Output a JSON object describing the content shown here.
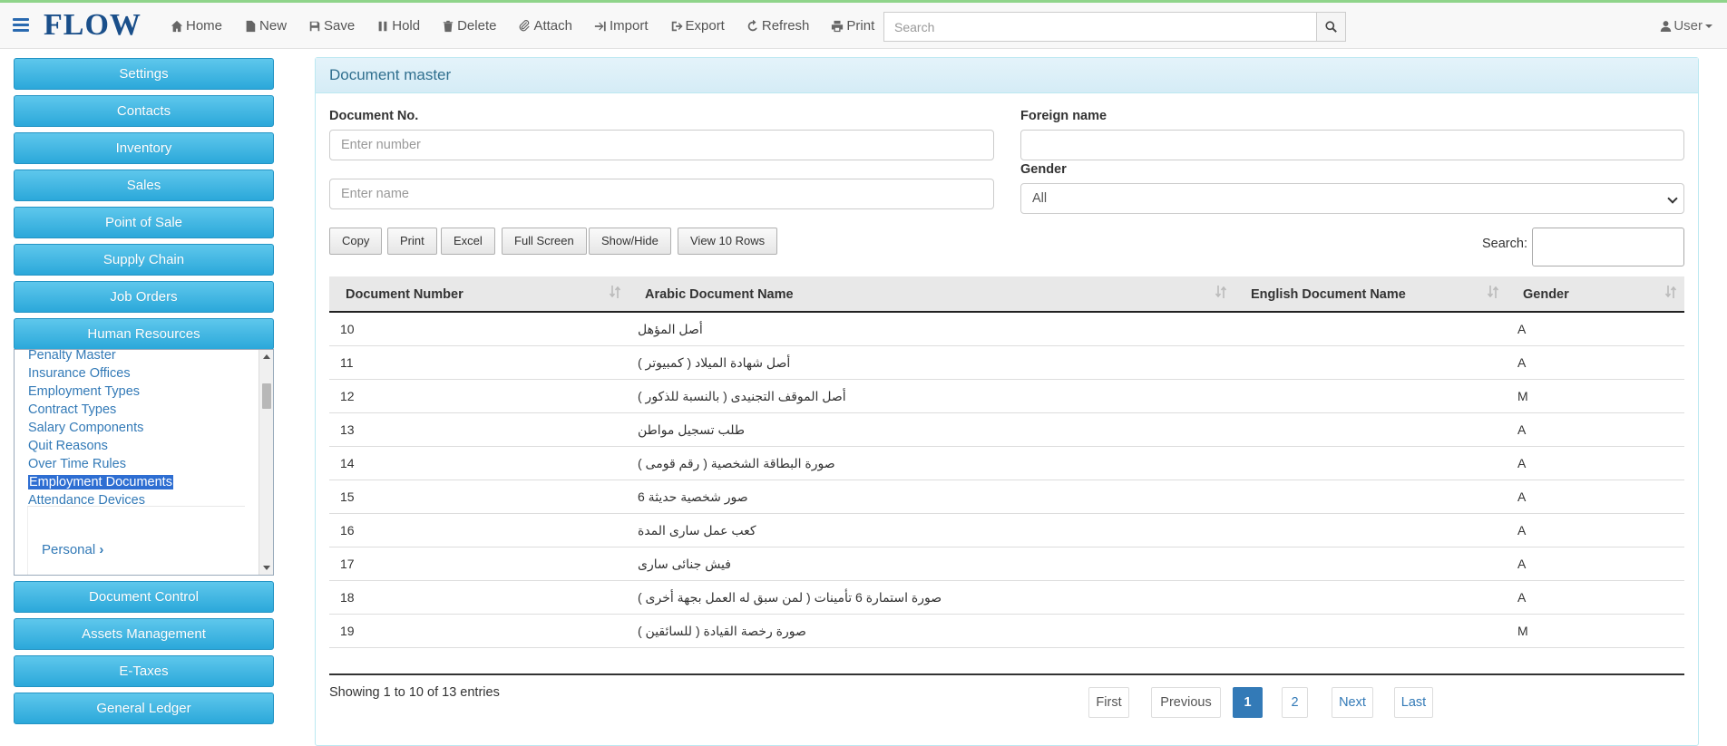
{
  "brand": {
    "logo": "FLOW"
  },
  "nav": {
    "items": [
      {
        "label": "Home",
        "icon": "home-icon"
      },
      {
        "label": "New",
        "icon": "file-icon"
      },
      {
        "label": "Save",
        "icon": "save-icon"
      },
      {
        "label": "Hold",
        "icon": "pause-icon"
      },
      {
        "label": "Delete",
        "icon": "trash-icon"
      },
      {
        "label": "Attach",
        "icon": "paperclip-icon"
      },
      {
        "label": "Import",
        "icon": "import-icon"
      },
      {
        "label": "Export",
        "icon": "export-icon"
      },
      {
        "label": "Refresh",
        "icon": "refresh-icon"
      },
      {
        "label": "Print",
        "icon": "print-icon"
      }
    ],
    "search_placeholder": "Search",
    "user_label": "User"
  },
  "sidebar": {
    "modules_top": [
      "Settings",
      "Contacts",
      "Inventory",
      "Sales",
      "Point of Sale",
      "Supply Chain",
      "Job Orders",
      "Human Resources"
    ],
    "submenu": {
      "links": [
        "Penalty Master",
        "Insurance Offices",
        "Employment Types",
        "Contract Types",
        "Salary Components",
        "Quit Reasons",
        "Over Time Rules",
        "Employment Documents",
        "Attendance Devices"
      ],
      "active": "Employment Documents",
      "personal": "Personal"
    },
    "modules_bottom": [
      "Document Control",
      "Assets Management",
      "E-Taxes",
      "General Ledger"
    ]
  },
  "panel": {
    "title": "Document master",
    "form": {
      "doc_no_label": "Document No.",
      "doc_no_placeholder": "Enter number",
      "name_placeholder": "Enter name",
      "foreign_label": "Foreign name",
      "gender_label": "Gender",
      "gender_value": "All"
    },
    "toolbar": [
      "Copy",
      "Print",
      "Excel",
      "Full Screen",
      "Show/Hide",
      "View 10 Rows"
    ],
    "search_label": "Search:",
    "table": {
      "headers": [
        "Document Number",
        "Arabic Document Name",
        "English Document Name",
        "Gender"
      ],
      "rows": [
        [
          "10",
          "أصل المؤهل",
          "",
          "A"
        ],
        [
          "11",
          "أصل شهادة الميلاد ( كمبيوتر )",
          "",
          "A"
        ],
        [
          "12",
          "أصل الموقف التجنيدى ( بالنسبة للذكور )",
          "",
          "M"
        ],
        [
          "13",
          "طلب تسجيل مواطن",
          "",
          "A"
        ],
        [
          "14",
          "صورة البطاقة الشخصية ( رقم قومى )",
          "",
          "A"
        ],
        [
          "15",
          "صور شخصية حديثة 6",
          "",
          "A"
        ],
        [
          "16",
          "كعب عمل سارى المدة",
          "",
          "A"
        ],
        [
          "17",
          "فيش جنائى سارى",
          "",
          "A"
        ],
        [
          "18",
          "صورة استمارة 6 تأمينات ( لمن سبق له العمل بجهة أخرى )",
          "",
          "A"
        ],
        [
          "19",
          "صورة رخصة القيادة ( للسائقين )",
          "",
          "M"
        ]
      ]
    },
    "info": "Showing 1 to 10 of 13 entries",
    "pagination": [
      "First",
      "Previous",
      "1",
      "2",
      "Next",
      "Last"
    ]
  }
}
